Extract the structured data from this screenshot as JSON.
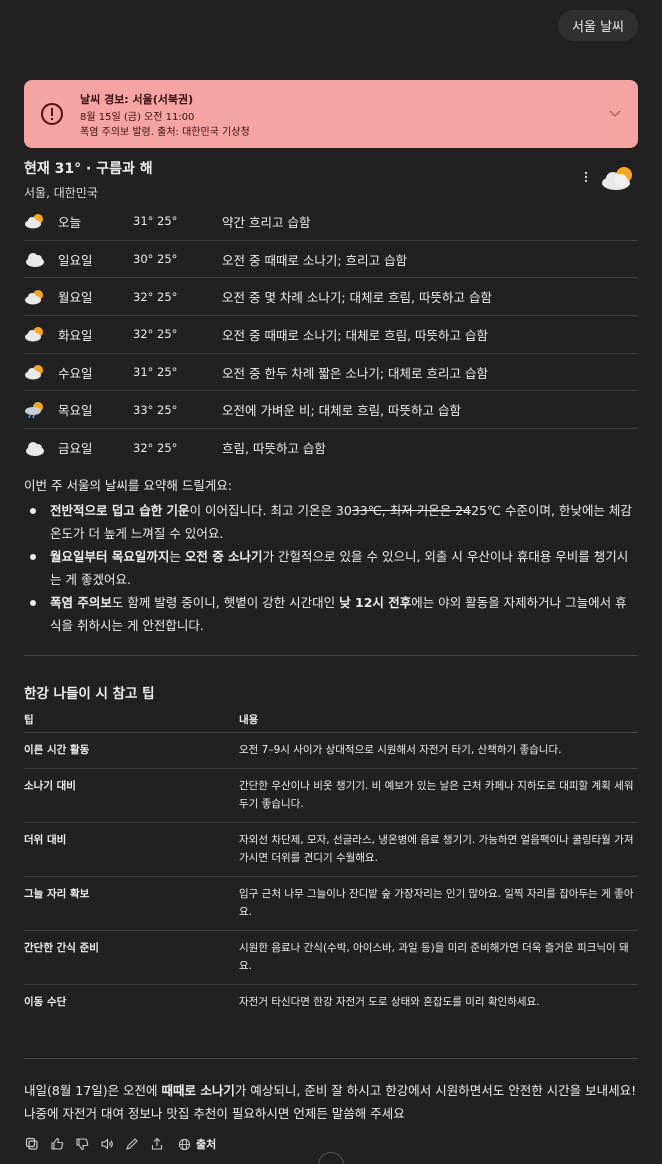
{
  "user_message": "서울 날씨",
  "alert": {
    "title": "날씨 경보: 서울(서북권)",
    "time": "8월 15일 (금) 오전 11:00",
    "body": "폭염 주의보 발령. 출처: 대한민국 기상청",
    "color": "#f5a3a3"
  },
  "current": {
    "temp": "현재 31° · 구름과 해",
    "location": "서울, 대한민국",
    "icon": "partly-sunny-icon"
  },
  "forecast": [
    {
      "day": "오늘",
      "temps": "31° 25°",
      "desc": "약간 흐리고 습함",
      "icon": "partly-sunny-icon"
    },
    {
      "day": "일요일",
      "temps": "30° 25°",
      "desc": "오전 중 때때로 소나기; 흐리고 습함",
      "icon": "cloud-icon"
    },
    {
      "day": "월요일",
      "temps": "32° 25°",
      "desc": "오전 중 몇 차례 소나기; 대체로 흐림, 따뜻하고 습함",
      "icon": "partly-sunny-icon"
    },
    {
      "day": "화요일",
      "temps": "32° 25°",
      "desc": "오전 중 때때로 소나기; 대체로 흐림, 따뜻하고 습함",
      "icon": "partly-sunny-icon"
    },
    {
      "day": "수요일",
      "temps": "31° 25°",
      "desc": "오전 중 한두 차례 짧은 소나기; 대체로 흐리고 습함",
      "icon": "partly-sunny-icon"
    },
    {
      "day": "목요일",
      "temps": "33° 25°",
      "desc": "오전에 가벼운 비; 대체로 흐림, 따뜻하고 습함",
      "icon": "sun-rain-icon"
    },
    {
      "day": "금요일",
      "temps": "32° 25°",
      "desc": "흐림, 따뜻하고 습함",
      "icon": "cloud-icon"
    }
  ],
  "summary": {
    "intro": "이번 주 서울의 날씨를 요약해 드릴게요:",
    "b1_bold": "전반적으로 덥고 습한 기운",
    "b1_a": "이 이어집니다. 최고 기온은 30",
    "b1_strike": "33℃, 최저 기온은 24",
    "b1_b": "25℃ 수준이며, 한낮에는 체감 온도가 더 높게 느껴질 수 있어요.",
    "b2_bold1": "월요일부터 목요일까지",
    "b2_a": "는 ",
    "b2_bold2": "오전 중 소나기",
    "b2_b": "가 간헐적으로 있을 수 있으니, 외출 시 우산이나 휴대용 우비를 챙기시는 게 좋겠어요.",
    "b3_bold1": "폭염 주의보",
    "b3_a": "도 함께 발령 중이니, 햇볕이 강한 시간대인 ",
    "b3_bold2": "낮 12시 전후",
    "b3_b": "에는 야외 활동을 자제하거나 그늘에서 휴식을 취하시는 게 안전합니다."
  },
  "tips": {
    "title": "한강 나들이 시 참고 팁",
    "col1": "팁",
    "col2": "내용",
    "rows": [
      {
        "tip": "이른 시간 활동",
        "content": "오전 7–9시 사이가 상대적으로 시원해서 자전거 타기, 산책하기 좋습니다."
      },
      {
        "tip": "소나기 대비",
        "content": "간단한 우산이나 비옷 챙기기. 비 예보가 있는 날은 근처 카페나 지하도로 대피할 계획 세워두기 좋습니다."
      },
      {
        "tip": "더위 대비",
        "content": "자외선 차단제, 모자, 선글라스, 냉온병에 음료 챙기기. 가능하면 얼음팩이나 쿨링타월 가져가시면 더위를 견디기 수월해요."
      },
      {
        "tip": "그늘 자리 확보",
        "content": "입구 근처 나무 그늘이나 잔디밭 숲 가장자리는 인기 많아요. 일찍 자리를 잡아두는 게 좋아요."
      },
      {
        "tip": "간단한 간식 준비",
        "content": "시원한 음료나 간식(수박, 아이스바, 과일 등)을 미리 준비해가면 더욱 즐거운 피크닉이 돼요."
      },
      {
        "tip": "이동 수단",
        "content": "자전거 타신다면 한강 자전거 도로 상태와 혼잡도를 미리 확인하세요."
      }
    ]
  },
  "closing": {
    "a": "내일(8월 17일)은 오전에 ",
    "bold": "때때로 소나기",
    "b": "가 예상되니, 준비 잘 하시고 한강에서 시원하면서도 안전한 시간을 보내세요! 나중에 자전거 대여 정보나 맛집 추천이 필요하시면 언제든 말씀해 주세요"
  },
  "actions": {
    "sources_label": "출처"
  }
}
